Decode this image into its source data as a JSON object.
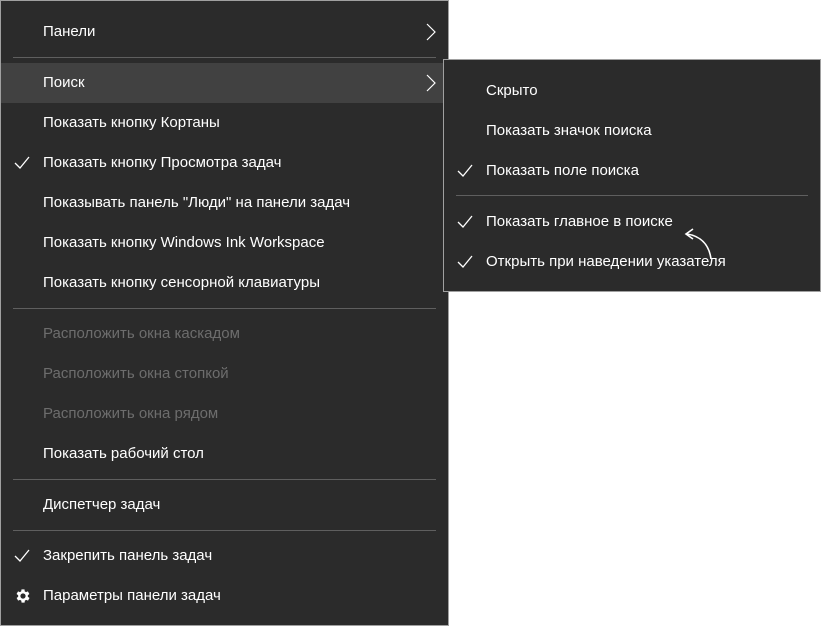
{
  "main_menu": {
    "items": [
      {
        "label": "Панели",
        "disabled": false,
        "checked": false,
        "submenu": true
      },
      {
        "label": "Поиск",
        "disabled": false,
        "checked": false,
        "submenu": true,
        "highlighted": true
      },
      {
        "label": "Показать кнопку Кортаны",
        "disabled": false,
        "checked": false
      },
      {
        "label": "Показать кнопку Просмотра задач",
        "disabled": false,
        "checked": true
      },
      {
        "label": "Показывать панель \"Люди\" на панели задач",
        "disabled": false,
        "checked": false
      },
      {
        "label": "Показать кнопку Windows Ink Workspace",
        "disabled": false,
        "checked": false
      },
      {
        "label": "Показать кнопку сенсорной клавиатуры",
        "disabled": false,
        "checked": false
      },
      {
        "label": "Расположить окна каскадом",
        "disabled": true,
        "checked": false
      },
      {
        "label": "Расположить окна стопкой",
        "disabled": true,
        "checked": false
      },
      {
        "label": "Расположить окна рядом",
        "disabled": true,
        "checked": false
      },
      {
        "label": "Показать рабочий стол",
        "disabled": false,
        "checked": false
      },
      {
        "label": "Диспетчер задач",
        "disabled": false,
        "checked": false
      },
      {
        "label": "Закрепить панель задач",
        "disabled": false,
        "checked": true
      },
      {
        "label": "Параметры панели задач",
        "disabled": false,
        "checked": false,
        "icon": "gear-icon"
      }
    ]
  },
  "search_submenu": {
    "items": [
      {
        "label": "Скрыто",
        "checked": false
      },
      {
        "label": "Показать значок поиска",
        "checked": false
      },
      {
        "label": "Показать поле поиска",
        "checked": true
      },
      {
        "label": "Показать главное в поиске",
        "checked": true
      },
      {
        "label": "Открыть при наведении указателя",
        "checked": true
      }
    ]
  },
  "colors": {
    "menu_bg": "#2b2b2b",
    "hover_bg": "#414141",
    "text": "#ffffff",
    "disabled_text": "#6d6d6d",
    "separator": "#5f5f5f",
    "border": "#a0a0a0"
  }
}
